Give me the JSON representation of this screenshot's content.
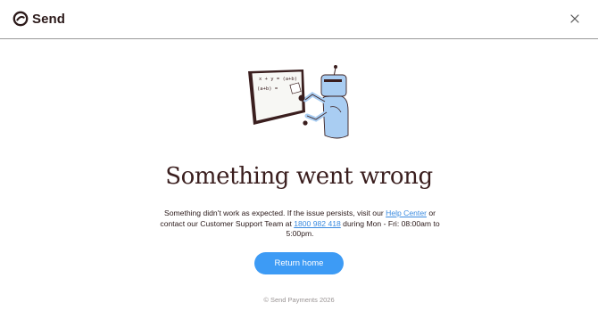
{
  "header": {
    "brand": "Send",
    "close_icon": "close-icon"
  },
  "illustration": {
    "name": "robot-at-whiteboard",
    "board_line_1": "x + y = (a+b)",
    "board_line_2": "(a+b) ="
  },
  "main": {
    "title": "Something went wrong",
    "message_part1": "Something didn't work as expected. If the issue persists, visit our ",
    "help_link": "Help Center",
    "message_part2": " or contact our Customer Support Team at ",
    "phone_link": "1800 982 418",
    "message_part3": " during Mon - Fri: 08:00am to 5:00pm.",
    "cta_label": "Return home"
  },
  "footer": {
    "copyright": "© Send Payments 2026"
  },
  "colors": {
    "accent": "#3d9bf5",
    "link": "#3b8be0",
    "text": "#2b1a1a",
    "robot": "#a9cdf2"
  }
}
